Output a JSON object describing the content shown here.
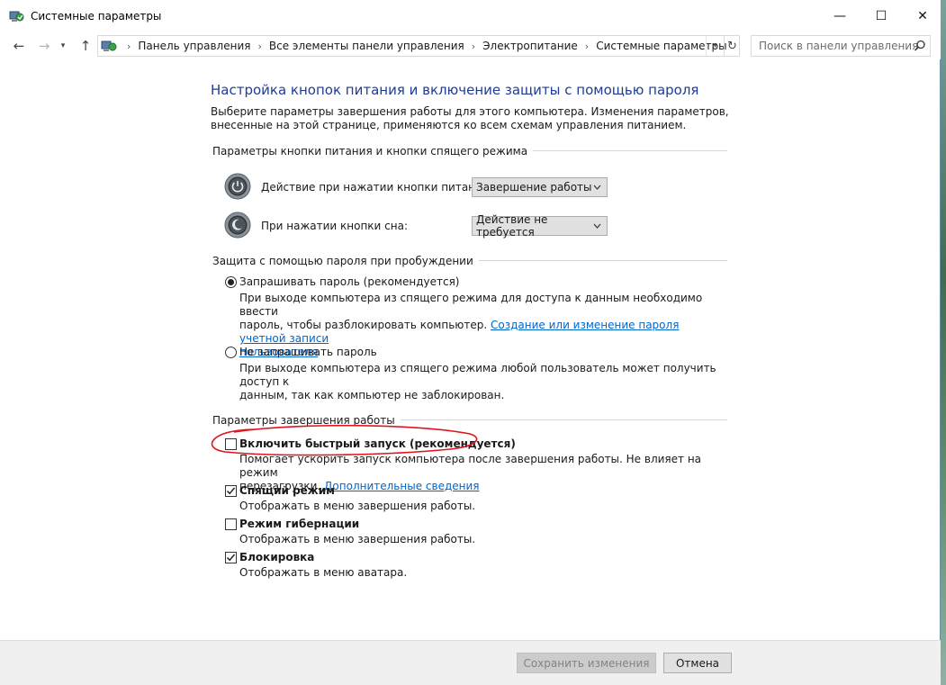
{
  "window": {
    "title": "Системные параметры",
    "controls": {
      "minimize": "—",
      "maximize": "☐",
      "close": "✕"
    }
  },
  "nav": {
    "back": "←",
    "forward": "→",
    "recent": "▾",
    "up": "↑",
    "breadcrumbs": [
      "Панель управления",
      "Все элементы панели управления",
      "Электропитание",
      "Системные параметры"
    ],
    "separator": "›",
    "address_dropdown": "▾",
    "refresh": "↻",
    "search_placeholder": "Поиск в панели управления"
  },
  "page": {
    "heading": "Настройка кнопок питания и включение защиты с помощью пароля",
    "intro": "Выберите параметры завершения работы для этого компьютера. Изменения параметров, внесенные на этой странице, применяются ко всем схемам управления питанием."
  },
  "power_buttons": {
    "group_title": "Параметры кнопки питания и кнопки спящего режима",
    "power_label": "Действие при нажатии кнопки питания:",
    "power_value": "Завершение работы",
    "sleep_label": "При нажатии кнопки сна:",
    "sleep_value": "Действие не требуется"
  },
  "password": {
    "group_title": "Защита с помощью пароля при пробуждении",
    "require_label": "Запрашивать пароль (рекомендуется)",
    "require_checked": true,
    "require_desc_1": "При выходе компьютера из спящего режима для доступа к данным необходимо ввести",
    "require_desc_2": "пароль, чтобы разблокировать компьютер. ",
    "require_link_1": "Создание или изменение пароля учетной записи",
    "require_link_2": "пользователя",
    "norequire_label": "Не запрашивать пароль",
    "norequire_checked": false,
    "norequire_desc_1": "При выходе компьютера из спящего режима любой пользователь может получить доступ к",
    "norequire_desc_2": "данным, так как компьютер не заблокирован."
  },
  "shutdown": {
    "group_title": "Параметры завершения работы",
    "fast_label": "Включить быстрый запуск (рекомендуется)",
    "fast_checked": false,
    "fast_desc_1": "Помогает ускорить запуск компьютера после завершения работы. Не влияет на режим",
    "fast_desc_2": "перезагрузки. ",
    "fast_link": "Дополнительные сведения",
    "sleep_label": "Спящий режим",
    "sleep_checked": true,
    "sleep_desc": "Отображать в меню завершения работы.",
    "hibernate_label": "Режим гибернации",
    "hibernate_checked": false,
    "hibernate_desc": "Отображать в меню завершения работы.",
    "lock_label": "Блокировка",
    "lock_checked": true,
    "lock_desc": "Отображать в меню аватара."
  },
  "footer": {
    "save_label": "Сохранить изменения",
    "cancel_label": "Отмена"
  },
  "colors": {
    "heading": "#1e3c96",
    "link": "#0066cc",
    "annotation": "#e0141e"
  }
}
